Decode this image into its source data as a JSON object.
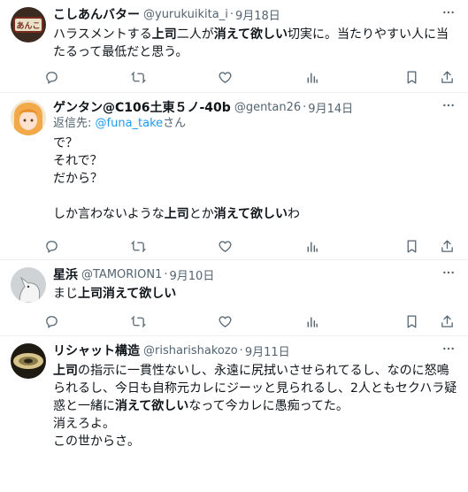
{
  "tweets": [
    {
      "name": "こしあんバター",
      "handle": "@yurukuikita_i",
      "date": "9月18日",
      "avatar_text": "あんこ",
      "text": [
        {
          "t": "ハラスメントする",
          "b": false
        },
        {
          "t": "上司",
          "b": true
        },
        {
          "t": "二人が",
          "b": false
        },
        {
          "t": "消えて欲しい",
          "b": true
        },
        {
          "t": "切実に。当たりやすい人に当たるって最低だと思う。",
          "b": false
        }
      ]
    },
    {
      "name": "ゲンタン@C106土東５ノ-40b",
      "handle": "@gentan26",
      "date": "9月14日",
      "reply_prefix": "返信先: ",
      "reply_link": "@funa_take",
      "reply_suffix": "さん",
      "text": [
        {
          "t": "で？\nそれで？\nだから？\n\nしか言わないような",
          "b": false
        },
        {
          "t": "上司",
          "b": true
        },
        {
          "t": "とか",
          "b": false
        },
        {
          "t": "消えて欲しい",
          "b": true
        },
        {
          "t": "わ",
          "b": false
        }
      ]
    },
    {
      "name": "星浜",
      "handle": "@TAMORION1",
      "date": "9月10日",
      "text": [
        {
          "t": "まじ",
          "b": false
        },
        {
          "t": "上司消えて欲しい",
          "b": true
        }
      ]
    },
    {
      "name": "リシャット構造",
      "handle": "@risharishakozo",
      "date": "9月11日",
      "text": [
        {
          "t": "上司",
          "b": true
        },
        {
          "t": "の指示に一貫性ないし、永遠に尻拭いさせられてるし、なのに怒鳴られるし、今日も自称元カレにジーッと見られるし、2人ともセクハラ疑惑と一緒に",
          "b": false
        },
        {
          "t": "消えて欲しい",
          "b": true
        },
        {
          "t": "なって今カレに愚痴ってた。\n消えろよ。\nこの世からさ。",
          "b": false
        }
      ]
    }
  ],
  "dot": "·",
  "icons": [
    "reply-icon",
    "retweet-icon",
    "like-icon",
    "views-icon",
    "bookmark-icon",
    "share-icon",
    "more-icon"
  ]
}
